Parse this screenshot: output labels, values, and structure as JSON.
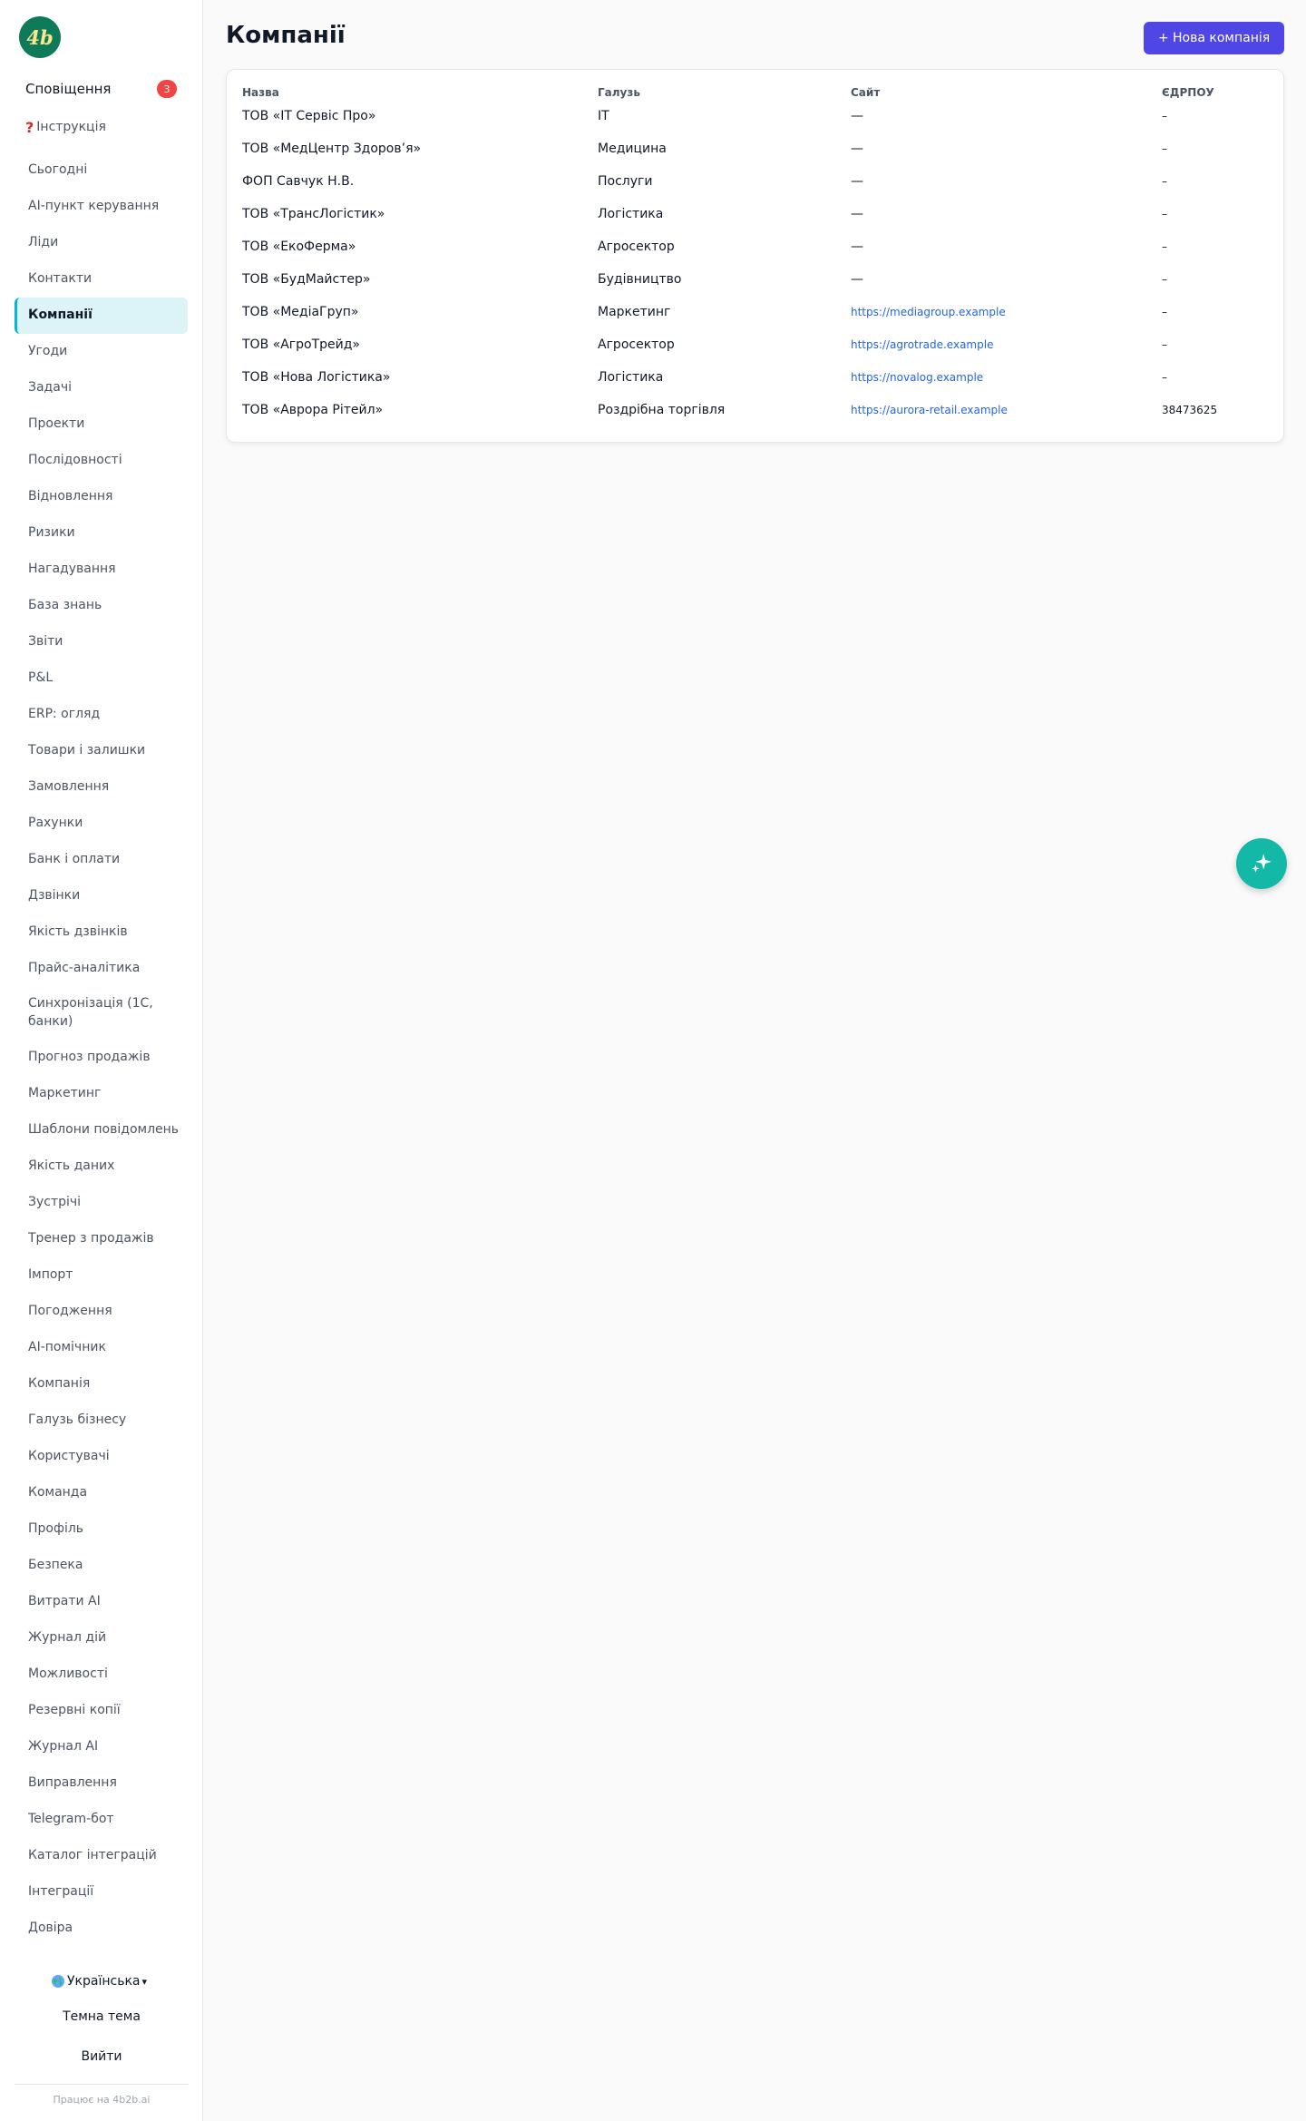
{
  "sidebar": {
    "logo_text": "4b",
    "notifications_label": "Сповіщення",
    "notifications_count": "3",
    "help_label": "Інструкція",
    "items": [
      {
        "label": "Сьогодні"
      },
      {
        "label": "AI-пункт керування"
      },
      {
        "label": "Ліди"
      },
      {
        "label": "Контакти"
      },
      {
        "label": "Компанії",
        "active": true
      },
      {
        "label": "Угоди"
      },
      {
        "label": "Задачі"
      },
      {
        "label": "Проекти"
      },
      {
        "label": "Послідовності"
      },
      {
        "label": "Відновлення"
      },
      {
        "label": "Ризики"
      },
      {
        "label": "Нагадування"
      },
      {
        "label": "База знань"
      },
      {
        "label": "Звіти"
      },
      {
        "label": "P&L"
      },
      {
        "label": "ERP: огляд"
      },
      {
        "label": "Товари і залишки"
      },
      {
        "label": "Замовлення"
      },
      {
        "label": "Рахунки"
      },
      {
        "label": "Банк і оплати"
      },
      {
        "label": "Дзвінки"
      },
      {
        "label": "Якість дзвінків"
      },
      {
        "label": "Прайс-аналітика"
      },
      {
        "label": "Синхронізація (1С, банки)"
      },
      {
        "label": "Прогноз продажів"
      },
      {
        "label": "Маркетинг"
      },
      {
        "label": "Шаблони повідомлень"
      },
      {
        "label": "Якість даних"
      },
      {
        "label": "Зустрічі"
      },
      {
        "label": "Тренер з продажів"
      },
      {
        "label": "Імпорт"
      },
      {
        "label": "Погодження"
      },
      {
        "label": "AI-помічник"
      },
      {
        "label": "Компанія"
      },
      {
        "label": "Галузь бізнесу"
      },
      {
        "label": "Користувачі"
      },
      {
        "label": "Команда"
      },
      {
        "label": "Профіль"
      },
      {
        "label": "Безпека"
      },
      {
        "label": "Витрати AI"
      },
      {
        "label": "Журнал дій"
      },
      {
        "label": "Можливості"
      },
      {
        "label": "Резервні копії"
      },
      {
        "label": "Журнал AI"
      },
      {
        "label": "Виправлення"
      },
      {
        "label": "Telegram-бот"
      },
      {
        "label": "Каталог інтеграцій"
      },
      {
        "label": "Інтеграції"
      },
      {
        "label": "Довіра"
      }
    ],
    "language_label": "Українська",
    "theme_label": "Темна тема",
    "logout_label": "Вийти",
    "powered_by": "Працює на 4b2b.ai"
  },
  "main": {
    "title": "Компанії",
    "new_button_label": "+ Нова компанія",
    "table": {
      "headers": [
        "Назва",
        "Галузь",
        "Сайт",
        "ЄДРПОУ"
      ],
      "rows": [
        [
          "ТОВ «IT Сервіс Про»",
          "IT",
          "—",
          "–"
        ],
        [
          "ТОВ «МедЦентр Здоров’я»",
          "Медицина",
          "—",
          "–"
        ],
        [
          "ФОП Савчук Н.В.",
          "Послуги",
          "—",
          "–"
        ],
        [
          "ТОВ «ТрансЛогістик»",
          "Логістика",
          "—",
          "–"
        ],
        [
          "ТОВ «ЕкоФерма»",
          "Агросектор",
          "—",
          "–"
        ],
        [
          "ТОВ «БудМайстер»",
          "Будівництво",
          "—",
          "–"
        ],
        [
          "ТОВ «МедіаГруп»",
          "Маркетинг",
          "https://mediagroup.example",
          "–"
        ],
        [
          "ТОВ «АгроТрейд»",
          "Агросектор",
          "https://agrotrade.example",
          "–"
        ],
        [
          "ТОВ «Нова Логістика»",
          "Логістика",
          "https://novalog.example",
          "–"
        ],
        [
          "ТОВ «Аврора Рітейл»",
          "Роздрібна торгівля",
          "https://aurora-retail.example",
          "38473625"
        ]
      ]
    }
  },
  "colors": {
    "accent": "#4f46e5",
    "active_nav_bg": "#dcf3f8",
    "active_nav_border": "#06b6d4",
    "badge": "#ef4444",
    "link": "#2563eb",
    "fab": "#14b8a6",
    "logo_bg": "#0f7a5a"
  },
  "icons": {
    "logo": "4b-logo",
    "help": "question-mark-icon",
    "language": "globe-icon",
    "fab": "sparkles-icon"
  }
}
